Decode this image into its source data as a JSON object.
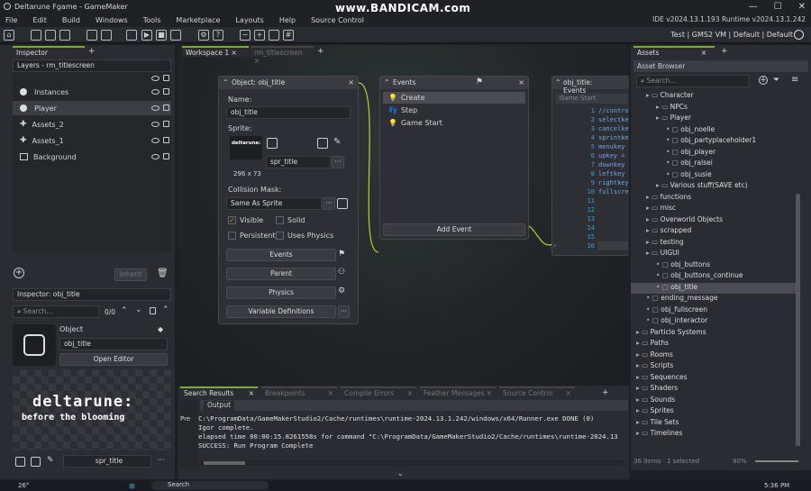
{
  "window": {
    "title": "Deltarune Fgame - GameMaker",
    "recorder": "www.BANDICAM.com",
    "controls": [
      "—",
      "☐",
      "✕"
    ]
  },
  "menu": [
    "File",
    "Edit",
    "Build",
    "Windows",
    "Tools",
    "Marketplace",
    "Layouts",
    "Help",
    "Source Control"
  ],
  "version_text": "IDE v2024.13.1.193  Runtime v2024.13.1.242",
  "toolbar_right": "Test | GMS2 VM | Default | Default",
  "inspector": {
    "tab": "Inspector",
    "layers_dropdown": "Layers - rm_titlescreen",
    "layers": [
      "Instances",
      "Player",
      "Assets_2",
      "Assets_1",
      "Background"
    ],
    "inherit_label": "Inherit",
    "bottom_dropdown": "Inspector: obj_title",
    "search_placeholder": "Search...",
    "count": "0/0",
    "object_label": "Object",
    "object_name": "obj_title",
    "open_editor": "Open Editor",
    "logo_line1": "deltarune:",
    "logo_line2": "before the blooming",
    "sprite_name": "spr_title"
  },
  "workspace": {
    "tabs": [
      "Workspace 1",
      "rm_titlescreen"
    ]
  },
  "object_window": {
    "title": "Object: obj_title",
    "name_label": "Name:",
    "name_value": "obj_title",
    "sprite_label": "Sprite:",
    "sprite_size": "296 x 73",
    "sprite_value": "spr_title",
    "collision_label": "Collision Mask:",
    "collision_value": "Same As Sprite",
    "visible": "Visible",
    "solid": "Solid",
    "persistent": "Persistent",
    "uses_physics": "Uses Physics",
    "buttons": [
      "Events",
      "Parent",
      "Physics",
      "Variable Definitions"
    ]
  },
  "events_window": {
    "title": "Events",
    "events": [
      "Create",
      "Step",
      "Game Start"
    ],
    "add_event": "Add Event"
  },
  "code_window": {
    "title": "obj_title: Events",
    "tab": "Game Start",
    "lines": [
      "//contro",
      "selectke",
      "cancelke",
      "sprintke",
      "menukey",
      "upkey =",
      "downkey",
      "leftkey",
      "rightkey",
      "fullscre",
      "",
      "",
      "",
      "",
      "",
      ""
    ],
    "line_numbers": [
      "1",
      "2",
      "3",
      "4",
      "5",
      "6",
      "7",
      "8",
      "9",
      "10",
      "11",
      "12",
      "13",
      "14",
      "15",
      "16"
    ]
  },
  "assets": {
    "tab": "Assets",
    "header": "Asset Browser",
    "search_placeholder": "Search...",
    "tree": [
      {
        "t": "Character",
        "d": 1,
        "k": "folder"
      },
      {
        "t": "NPCs",
        "d": 2,
        "k": "folder"
      },
      {
        "t": "Player",
        "d": 2,
        "k": "folder"
      },
      {
        "t": "obj_noelle",
        "d": 3,
        "k": "obj"
      },
      {
        "t": "obj_partyplaceholder1",
        "d": 3,
        "k": "obj"
      },
      {
        "t": "obj_player",
        "d": 3,
        "k": "obj"
      },
      {
        "t": "obj_ralsei",
        "d": 3,
        "k": "obj"
      },
      {
        "t": "obj_susie",
        "d": 3,
        "k": "obj"
      },
      {
        "t": "Various stuff(SAVE etc)",
        "d": 2,
        "k": "folder"
      },
      {
        "t": "functions",
        "d": 1,
        "k": "folder"
      },
      {
        "t": "misc",
        "d": 1,
        "k": "folder"
      },
      {
        "t": "Overworld Objects",
        "d": 1,
        "k": "folder"
      },
      {
        "t": "scrapped",
        "d": 1,
        "k": "folder"
      },
      {
        "t": "testing",
        "d": 1,
        "k": "folder"
      },
      {
        "t": "UIGUI",
        "d": 1,
        "k": "folder"
      },
      {
        "t": "obj_buttons",
        "d": 2,
        "k": "obj"
      },
      {
        "t": "obj_buttons_continue",
        "d": 2,
        "k": "obj"
      },
      {
        "t": "obj_title",
        "d": 2,
        "k": "obj",
        "sel": true
      },
      {
        "t": "ending_message",
        "d": 1,
        "k": "obj"
      },
      {
        "t": "obj_fullscreen",
        "d": 1,
        "k": "obj"
      },
      {
        "t": "obj_interactor",
        "d": 1,
        "k": "obj"
      },
      {
        "t": "Particle Systems",
        "d": 0,
        "k": "folder"
      },
      {
        "t": "Paths",
        "d": 0,
        "k": "folder"
      },
      {
        "t": "Rooms",
        "d": 0,
        "k": "folder"
      },
      {
        "t": "Scripts",
        "d": 0,
        "k": "folder"
      },
      {
        "t": "Sequences",
        "d": 0,
        "k": "folder"
      },
      {
        "t": "Shaders",
        "d": 0,
        "k": "folder"
      },
      {
        "t": "Sounds",
        "d": 0,
        "k": "folder"
      },
      {
        "t": "Sprites",
        "d": 0,
        "k": "folder"
      },
      {
        "t": "Tile Sets",
        "d": 0,
        "k": "folder"
      },
      {
        "t": "Timelines",
        "d": 0,
        "k": "folder"
      }
    ],
    "status_items": "36 items",
    "status_selected": "1 selected",
    "zoom": "90%"
  },
  "output": {
    "tabs": [
      "Search Results",
      "Breakpoints",
      "Compile Errors",
      "Feather Messages",
      "Source Control"
    ],
    "output_tab": "Output",
    "pre_label": "Pre",
    "lines": [
      "C:\\ProgramData/GameMakerStudio2/Cache/runtimes\\runtime-2024.13.1.242/windows/x64/Runner.exe DONE (0)",
      "Igor complete.",
      "elapsed time 00:00:15.8261558s for command \"C:\\ProgramData/GameMakerStudio2/Cache/runtimes\\runtime-2024.13",
      "SUCCESS: Run Program Complete"
    ]
  },
  "taskbar": {
    "weather": "26°",
    "search": "Search",
    "time": "5:36 PM"
  }
}
